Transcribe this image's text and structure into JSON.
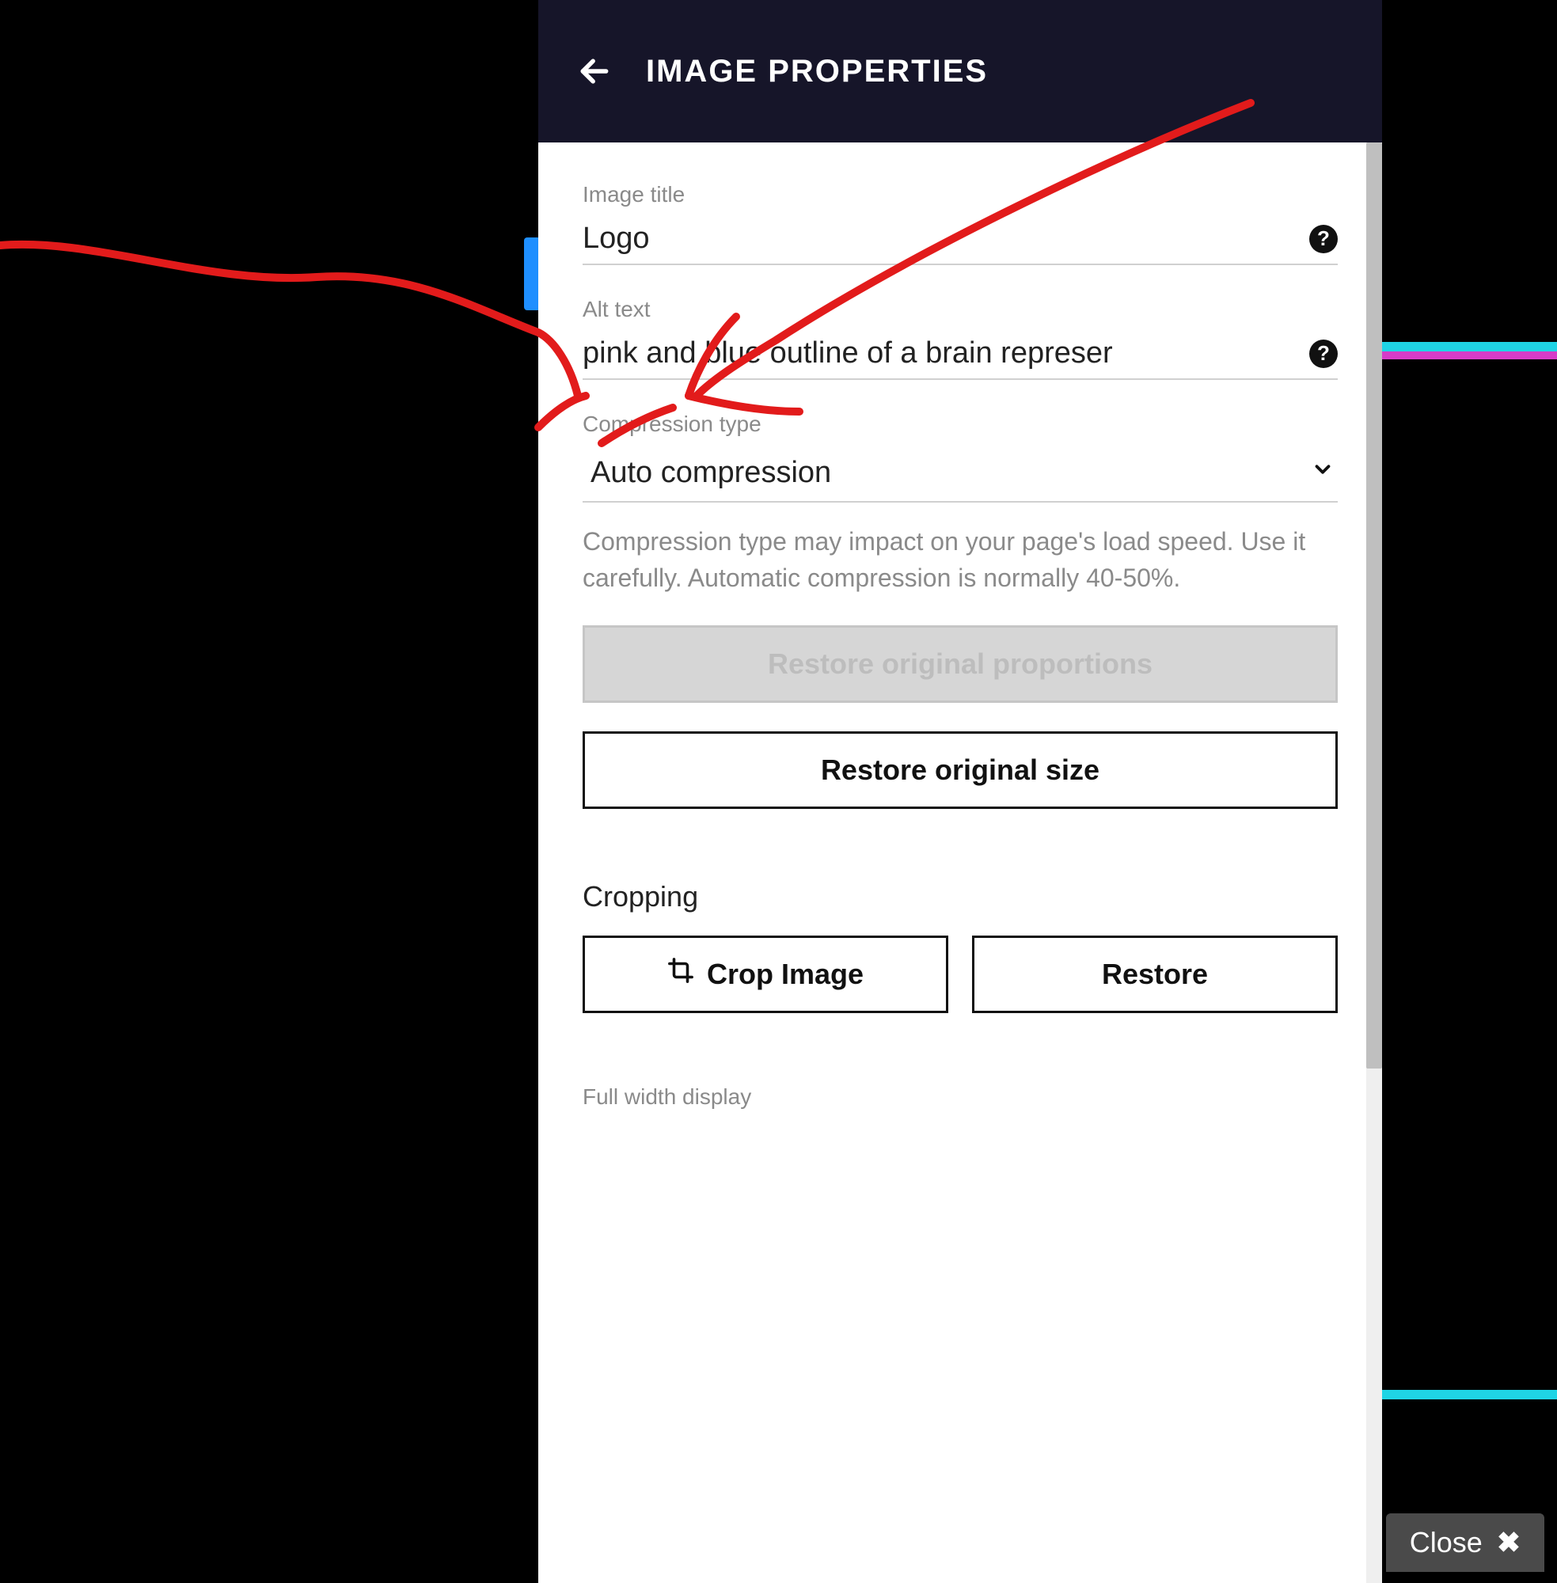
{
  "header": {
    "title": "IMAGE PROPERTIES"
  },
  "fields": {
    "image_title": {
      "label": "Image title",
      "value": "Logo"
    },
    "alt_text": {
      "label": "Alt text",
      "value": "pink and blue outline of a brain represer"
    },
    "compression": {
      "label": "Compression type",
      "value": "Auto compression",
      "help": "Compression type may impact on your page's load speed. Use it carefully. Automatic compression is normally 40-50%."
    }
  },
  "buttons": {
    "restore_proportions": "Restore original proportions",
    "restore_size": "Restore original size",
    "crop_image": "Crop Image",
    "restore": "Restore"
  },
  "sections": {
    "cropping": "Cropping",
    "full_width": "Full width display"
  },
  "close": {
    "label": "Close"
  }
}
